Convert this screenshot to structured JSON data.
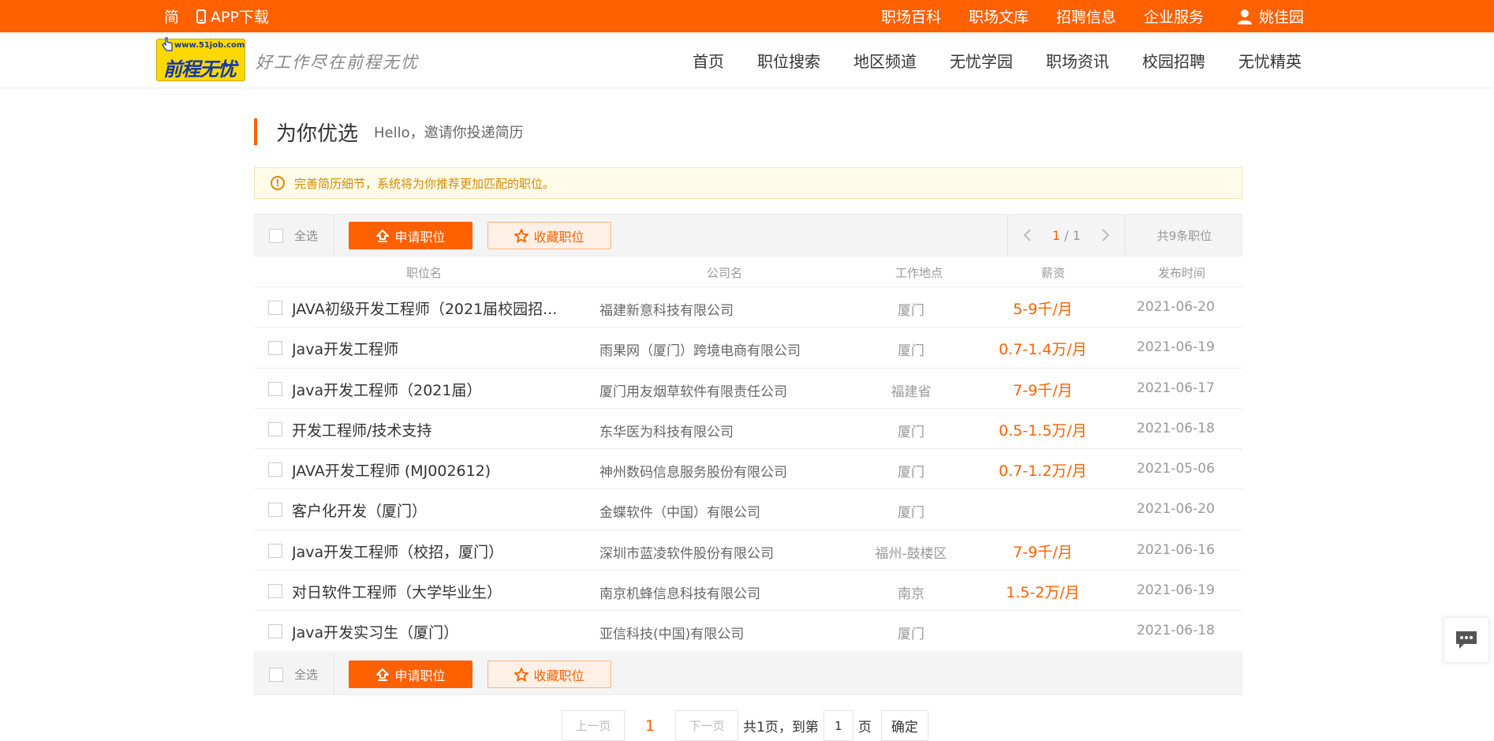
{
  "topbar": {
    "jian": "简",
    "app": "APP下载",
    "links": [
      "职场百科",
      "职场文库",
      "招聘信息",
      "企业服务"
    ],
    "user": "姚佳园"
  },
  "header": {
    "logo_url": "www.51job.com",
    "logo_name": "前程无忧",
    "slogan": "好工作尽在前程无忧",
    "nav": [
      "首页",
      "职位搜索",
      "地区频道",
      "无忧学园",
      "职场资讯",
      "校园招聘",
      "无忧精英"
    ]
  },
  "section": {
    "title": "为你优选",
    "subtitle": "Hello，邀请你投递简历"
  },
  "notice": "完善简历细节，系统将为你推荐更加匹配的职位。",
  "toolbar": {
    "select_all": "全选",
    "apply": "申请职位",
    "favorite": "收藏职位",
    "page_current": "1",
    "page_sep": "/",
    "page_total": "1",
    "total": "共9条职位"
  },
  "table": {
    "headers": [
      "职位名",
      "公司名",
      "工作地点",
      "薪资",
      "发布时间"
    ],
    "rows": [
      {
        "title": "JAVA初级开发工程师（2021届校园招...",
        "company": "福建新意科技有限公司",
        "location": "厦门",
        "salary": "5-9千/月",
        "date": "2021-06-20"
      },
      {
        "title": "Java开发工程师",
        "company": "雨果网（厦门）跨境电商有限公司",
        "location": "厦门",
        "salary": "0.7-1.4万/月",
        "date": "2021-06-19"
      },
      {
        "title": "Java开发工程师（2021届）",
        "company": "厦门用友烟草软件有限责任公司",
        "location": "福建省",
        "salary": "7-9千/月",
        "date": "2021-06-17"
      },
      {
        "title": "开发工程师/技术支持",
        "company": "东华医为科技有限公司",
        "location": "厦门",
        "salary": "0.5-1.5万/月",
        "date": "2021-06-18"
      },
      {
        "title": "JAVA开发工程师 (MJ002612)",
        "company": "神州数码信息服务股份有限公司",
        "location": "厦门",
        "salary": "0.7-1.2万/月",
        "date": "2021-05-06"
      },
      {
        "title": "客户化开发（厦门）",
        "company": "金蝶软件（中国）有限公司",
        "location": "厦门",
        "salary": "",
        "date": "2021-06-20"
      },
      {
        "title": "Java开发工程师（校招，厦门）",
        "company": "深圳市蓝凌软件股份有限公司",
        "location": "福州-鼓楼区",
        "salary": "7-9千/月",
        "date": "2021-06-16"
      },
      {
        "title": "对日软件工程师（大学毕业生）",
        "company": "南京机蜂信息科技有限公司",
        "location": "南京",
        "salary": "1.5-2万/月",
        "date": "2021-06-19"
      },
      {
        "title": "Java开发实习生（厦门）",
        "company": "亚信科技(中国)有限公司",
        "location": "厦门",
        "salary": "",
        "date": "2021-06-18"
      }
    ]
  },
  "pagination": {
    "prev": "上一页",
    "current": "1",
    "next": "下一页",
    "total_text": "共1页，到第",
    "input_value": "1",
    "page_unit": "页",
    "confirm": "确定"
  },
  "colors": {
    "brand": "#ff6000",
    "notice_text": "#d38b00",
    "notice_bg": "#fffbe9"
  }
}
